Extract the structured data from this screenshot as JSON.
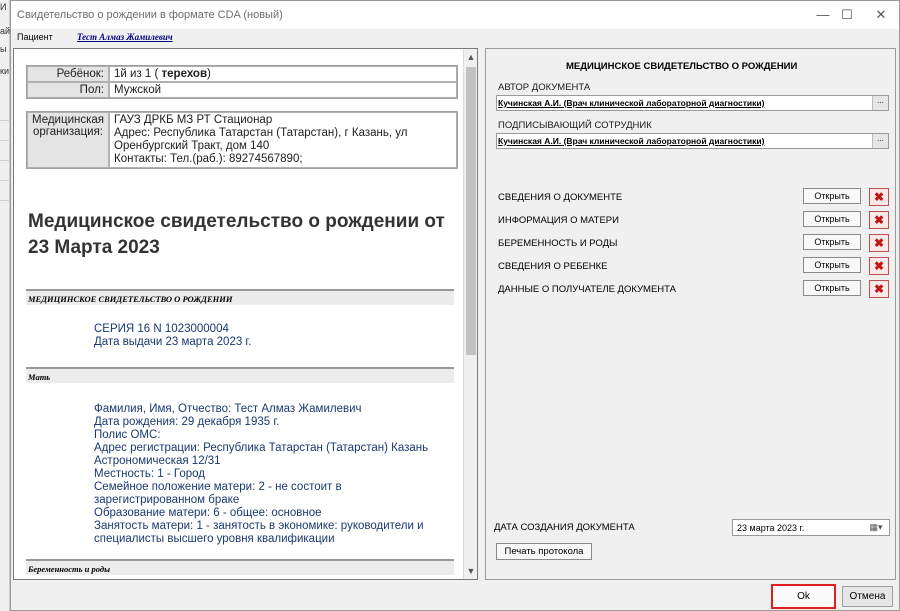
{
  "background_app": {
    "fragments": [
      "И",
      "ай",
      "ы",
      "ки"
    ]
  },
  "window": {
    "title": "Свидетельство о рождении в формате CDA (новый)",
    "minimize": "—",
    "maximize": "☐",
    "close": "✕"
  },
  "patient": {
    "label": "Пациент",
    "name": "Тест Алмаз Жамилевич"
  },
  "doc": {
    "child": {
      "label": "Ребёнок:",
      "value_prefix": "1й из 1 ( ",
      "value_bold": "терехов",
      "value_suffix": ")",
      "sex_label": "Пол:",
      "sex": "Мужской"
    },
    "org": {
      "label_line1": "Медицинская",
      "label_line2": "организация:",
      "line1": "ГАУЗ ДРКБ МЗ РТ Стационар",
      "line2": "Адрес: Республика Татарстан (Татарстан), г Казань, ул",
      "line3": "Оренбургский Тракт, дом 140",
      "line4": "Контакты: Тел.(раб.): 89274567890;"
    },
    "heading": "Медицинское свидетельство о рождении от 23 Марта 2023",
    "section1_title": "МЕДИЦИНСКОЕ СВИДЕТЕЛЬСТВО О РОЖДЕНИИ",
    "series": "СЕРИЯ 16 N 1023000004",
    "issue_date": "Дата выдачи 23 марта 2023 г.",
    "section2_title": "Мать",
    "mother_lines": [
      "Фамилия, Имя, Отчество: Тест Алмаз Жамилевич",
      "Дата рождения: 29 декабря 1935 г.",
      "Полис ОМС:",
      "Адрес регистрации: Республика Татарстан (Татарстан) Казань",
      "Астрономическая 12/31",
      "Местность: 1 - Город",
      "Семейное положение матери: 2 - не состоит в",
      "зарегистрированном браке",
      "Образование матери: 6 - общее: основное",
      "Занятость матери: 1 - занятость в экономике: руководители и",
      "специалисты высшего уровня квалификации"
    ],
    "section3_title": "Беременность и роды"
  },
  "form": {
    "title": "МЕДИЦИНСКОЕ СВИДЕТЕЛЬСТВО О РОЖДЕНИИ",
    "author_label": "АВТОР ДОКУМЕНТА",
    "author_value": "Кучинская А.И. (Врач клинической лабораторной диагностики)",
    "signer_label": "ПОДПИСЫВАЮЩИЙ СОТРУДНИК",
    "signer_value": "Кучинская А.И. (Врач клинической лабораторной диагностики)",
    "ellipsis": "...",
    "sections": [
      {
        "label": "СВЕДЕНИЯ О ДОКУМЕНТЕ",
        "button": "Открыть"
      },
      {
        "label": "ИНФОРМАЦИЯ О МАТЕРИ",
        "button": "Открыть"
      },
      {
        "label": "БЕРЕМЕННОСТЬ И РОДЫ",
        "button": "Открыть"
      },
      {
        "label": "СВЕДЕНИЯ О РЕБЕНКЕ",
        "button": "Открыть"
      },
      {
        "label": "ДАННЫЕ О ПОЛУЧАТЕЛЕ ДОКУМЕНТА",
        "button": "Открыть"
      }
    ],
    "date_label": "ДАТА СОЗДАНИЯ ДОКУМЕНТА",
    "date_value": "23   марта   2023 г.",
    "print_button": "Печать протокола"
  },
  "buttons": {
    "ok": "Ok",
    "cancel": "Отмена"
  },
  "colors": {
    "highlight": "#e02020",
    "link": "#000080",
    "doc_text": "#1a3a70"
  }
}
